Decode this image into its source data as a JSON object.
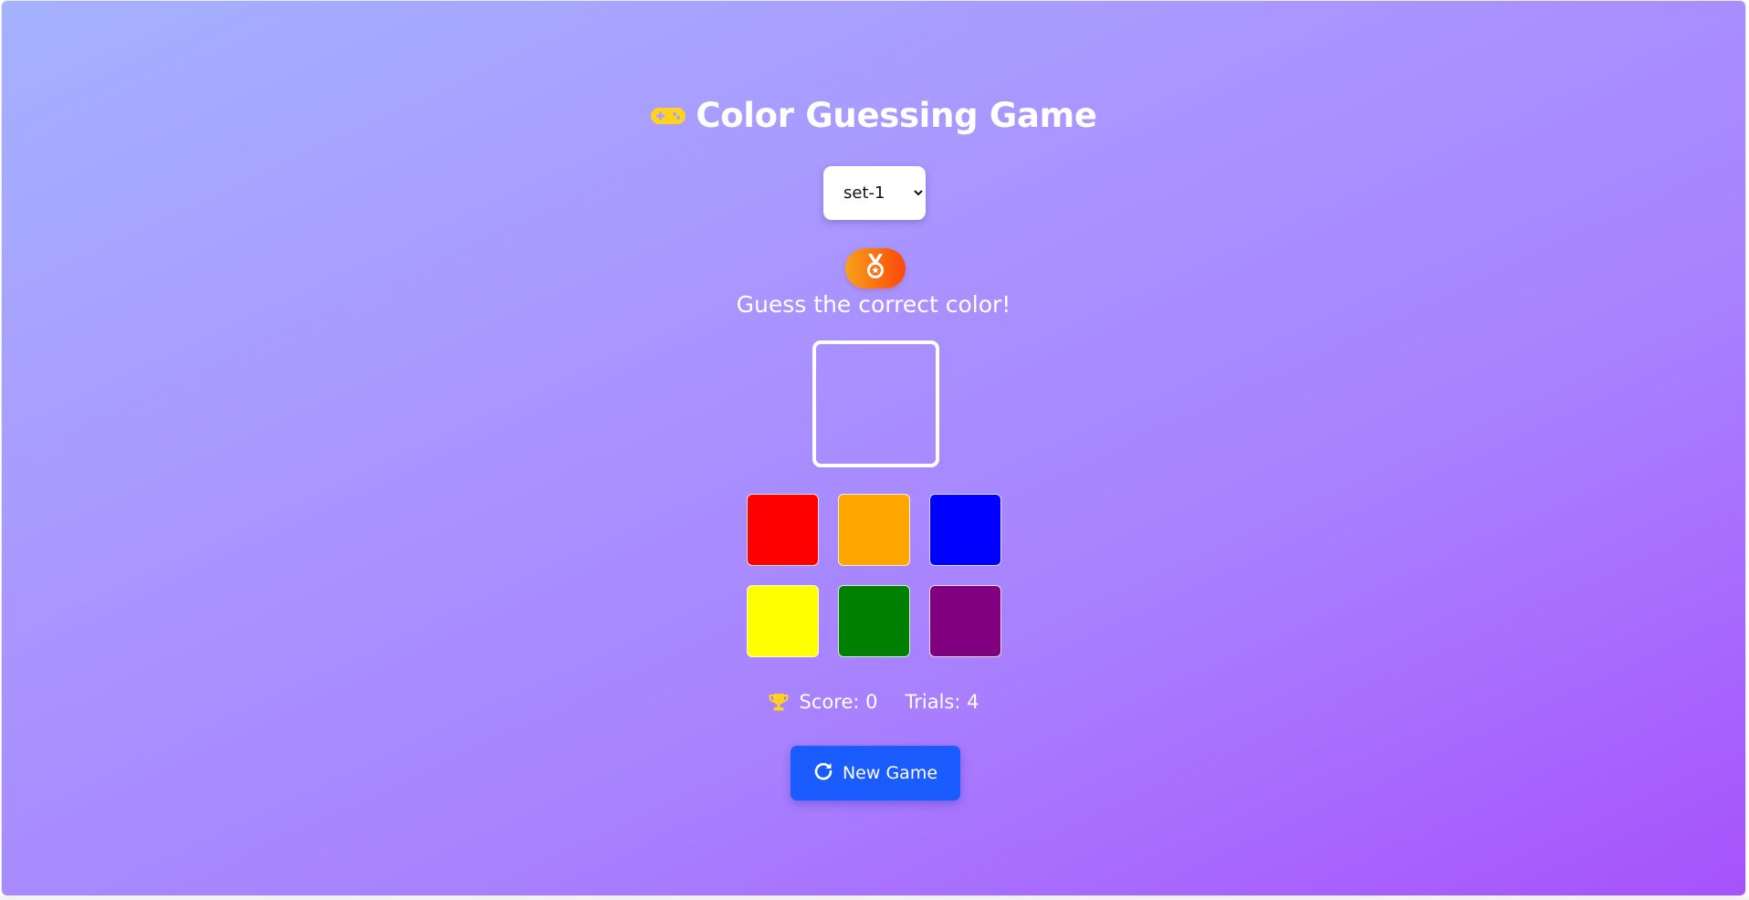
{
  "title": {
    "text": "Color Guessing Game",
    "icon": "gamepad-icon",
    "icon_color": "#ffd21f"
  },
  "set_select": {
    "selected": "set-1",
    "options": [
      "set-1"
    ]
  },
  "badge": {
    "icon": "medal-icon",
    "colors": [
      "#f8a219",
      "#f94a0c"
    ]
  },
  "prompt": "Guess the correct color!",
  "target": {
    "border_color": "#ffffff"
  },
  "swatches": [
    {
      "name": "red",
      "color": "#ff0000"
    },
    {
      "name": "orange",
      "color": "#ffa500"
    },
    {
      "name": "blue",
      "color": "#0000ff"
    },
    {
      "name": "yellow",
      "color": "#ffff00"
    },
    {
      "name": "green",
      "color": "#008000"
    },
    {
      "name": "purple",
      "color": "#800080"
    }
  ],
  "stats": {
    "trophy_icon": "trophy-icon",
    "score_text": "Score: 0",
    "trials_text": "Trials: 4"
  },
  "new_game_button": {
    "label": "New Game",
    "icon": "refresh-icon",
    "color": "#1a5cff"
  }
}
